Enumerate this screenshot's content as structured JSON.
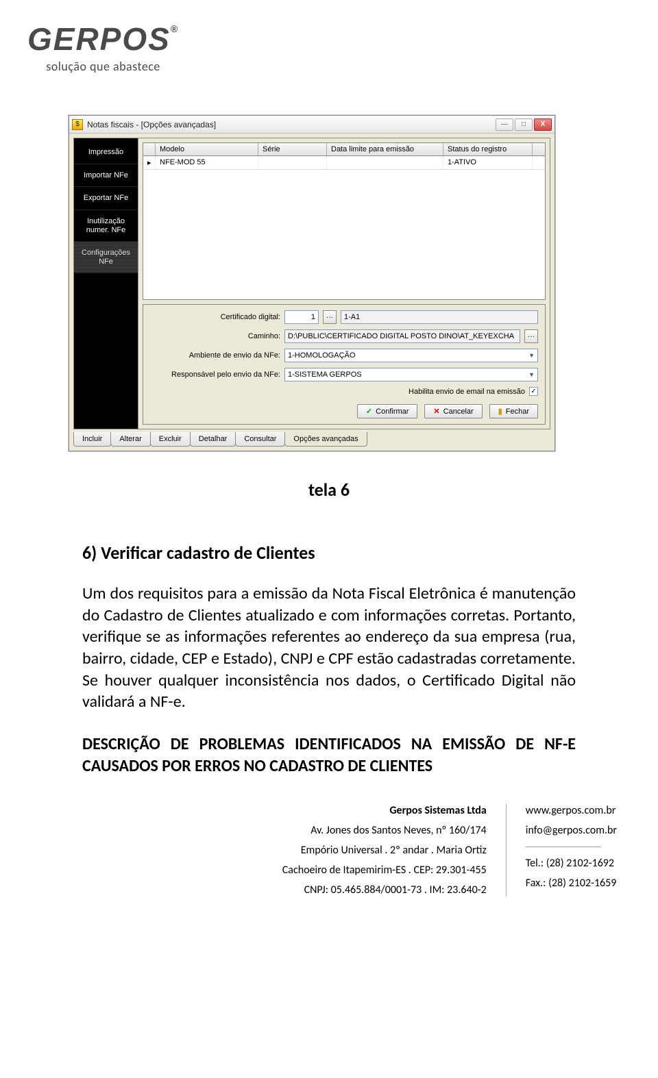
{
  "letterhead": {
    "brand": "GERPOS",
    "reg": "®",
    "tagline": "solução que abastece"
  },
  "window": {
    "title": "Notas fiscais - [Opções avançadas]",
    "controls": {
      "min": "—",
      "max": "□",
      "close": "X"
    },
    "sidebar": {
      "items": [
        {
          "label": "Impressão"
        },
        {
          "label": "Importar NFe"
        },
        {
          "label": "Exportar NFe"
        },
        {
          "label": "Inutilização numer. NFe"
        },
        {
          "label": "Configurações NFe",
          "selected": true
        }
      ]
    },
    "grid": {
      "headers": {
        "modelo": "Modelo",
        "serie": "Série",
        "dataLimite": "Data limite para emissão",
        "status": "Status do registro"
      },
      "row": {
        "marker": "▸",
        "modelo": "NFE-MOD 55",
        "serie": "",
        "dataLimite": "",
        "status": "1-ATIVO"
      }
    },
    "form": {
      "certLabel": "Certificado digital:",
      "certValue": "1",
      "certDesc": "1-A1",
      "caminhoLabel": "Caminho:",
      "caminhoValue": "D:\\PUBLIC\\CERTIFICADO DIGITAL POSTO DINO\\AT_KEYEXCHA",
      "ambienteLabel": "Ambiente de envio da NFe:",
      "ambienteValue": "1-HOMOLOGAÇÃO",
      "responsavelLabel": "Responsável pelo envio da NFe:",
      "responsavelValue": "1-SISTEMA GERPOS",
      "habilitaLabel": "Habilita envio de email na emissão",
      "buttons": {
        "confirmar": "Confirmar",
        "cancelar": "Cancelar",
        "fechar": "Fechar"
      },
      "ellipsis": "···"
    },
    "tabs": [
      "Incluir",
      "Alterar",
      "Excluir",
      "Detalhar",
      "Consultar",
      "Opções avançadas"
    ]
  },
  "doc": {
    "caption": "tela 6",
    "sectionTitle": "6) Verificar cadastro de Clientes",
    "para1": "Um dos requisitos para a emissão da Nota Fiscal Eletrônica é manutenção do Cadastro de Clientes atualizado e com informações corretas. Portanto, verifique se as informações referentes ao endereço da sua empresa (rua, bairro, cidade, CEP e Estado), CNPJ e CPF estão cadastradas corretamente. Se houver qualquer inconsistência nos dados, o Certificado Digital não validará a NF-e.",
    "heading2": "DESCRIÇÃO DE PROBLEMAS IDENTIFICADOS NA EMISSÃO DE NF-E CAUSADOS POR ERROS NO CADASTRO DE CLIENTES"
  },
  "footer": {
    "company": "Gerpos Sistemas Ltda",
    "addr1": "Av. Jones dos Santos Neves, nº 160/174",
    "addr2": "Empório Universal . 2º andar . Maria Ortiz",
    "addr3": "Cachoeiro de Itapemirim-ES . CEP: 29.301-455",
    "addr4": "CNPJ: 05.465.884/0001-73 . IM: 23.640-2",
    "site": "www.gerpos.com.br",
    "email": "info@gerpos.com.br",
    "tel": "Tel.: (28) 2102-1692",
    "fax": "Fax.: (28) 2102-1659"
  }
}
